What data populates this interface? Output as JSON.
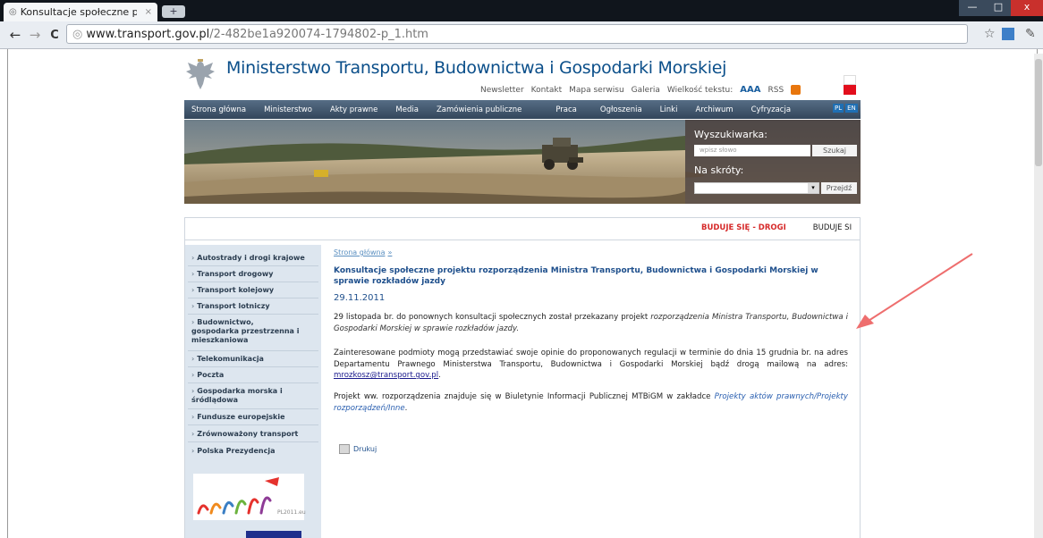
{
  "browser": {
    "tab_title": "Konsultacje społeczne proje",
    "tab_close": "×",
    "new_tab": "+",
    "win_min": "—",
    "win_max": "□",
    "win_close": "x",
    "back": "←",
    "forward": "→",
    "reload": "C",
    "url_host": "www.transport.gov.pl",
    "url_path": "/2-482be1a920074-1794802-p_1.htm",
    "star_icon": "☆",
    "wrench_icon": "✎"
  },
  "site": {
    "title": "Ministerstwo Transportu, Budownictwa i Gospodarki Morskiej",
    "toplinks": [
      "Newsletter",
      "Kontakt",
      "Mapa serwisu",
      "Galeria"
    ],
    "text_size_label": "Wielkość tekstu:",
    "text_size_value": "AAA",
    "rss_label": "RSS"
  },
  "menu": {
    "items": [
      "Strona główna",
      "Ministerstwo",
      "Akty prawne",
      "Media",
      "Zamówienia publiczne",
      "Praca",
      "Ogłoszenia",
      "Linki",
      "Archiwum",
      "Cyfryzacja"
    ],
    "langs": [
      "PL",
      "EN"
    ]
  },
  "search": {
    "title": "Wyszukiwarka:",
    "placeholder": "wpisz słowo",
    "button": "Szukaj",
    "shortcuts_title": "Na skróty:",
    "shortcuts_button": "Przejdź"
  },
  "ticker": {
    "item1": "BUDUJE SIĘ - DROGI",
    "item2": "BUDUJE SI"
  },
  "sidebar": {
    "items": [
      "Autostrady i drogi krajowe",
      "Transport drogowy",
      "Transport kolejowy",
      "Transport lotniczy",
      "Budownictwo, gospodarka przestrzenna i mieszkaniowa",
      "Telekomunikacja",
      "Poczta",
      "Gospodarka morska i śródlądowa",
      "Fundusze europejskie",
      "Zrównoważony transport",
      "Polska Prezydencja"
    ],
    "logo_text": "PL2011.eu"
  },
  "article": {
    "breadcrumb": "Strona główna",
    "breadcrumb_sep": "»",
    "title": "Konsultacje społeczne projektu rozporządzenia Ministra Transportu, Budownictwa i Gospodarki Morskiej w sprawie rozkładów jazdy",
    "date": "29.11.2011",
    "p1_start": "29 listopada br. do ponownych konsultacji społecznych został przekazany projekt ",
    "p1_italic": "rozporządzenia Ministra Transportu, Budownictwa i Gospodarki Morskiej w sprawie rozkładów jazdy.",
    "p2_start": "Zainteresowane podmioty mogą przedstawiać swoje opinie do proponowanych regulacji w terminie do dnia 15 grudnia br. na adres Departamentu Prawnego Ministerstwa Transportu, Budownictwa i Gospodarki Morskiej bądź drogą mailową na adres: ",
    "p2_email": "mrozkosz@transport.gov.pl",
    "p2_end": ".",
    "p3_start": "Projekt ww. rozporządzenia znajduje się w Biuletynie Informacji Publicznej MTBiGM w zakładce ",
    "p3_link": "Projekty aktów prawnych/Projekty rozporządzeń/Inne",
    "p3_end": ".",
    "print_label": "Drukuj"
  },
  "colors": {
    "title_blue": "#0b4f8a",
    "menu_bg": "#3f546b",
    "ticker_red": "#d62a2a",
    "sidebar_bg": "#dde6ef",
    "arrow": "#ee6e6e"
  }
}
